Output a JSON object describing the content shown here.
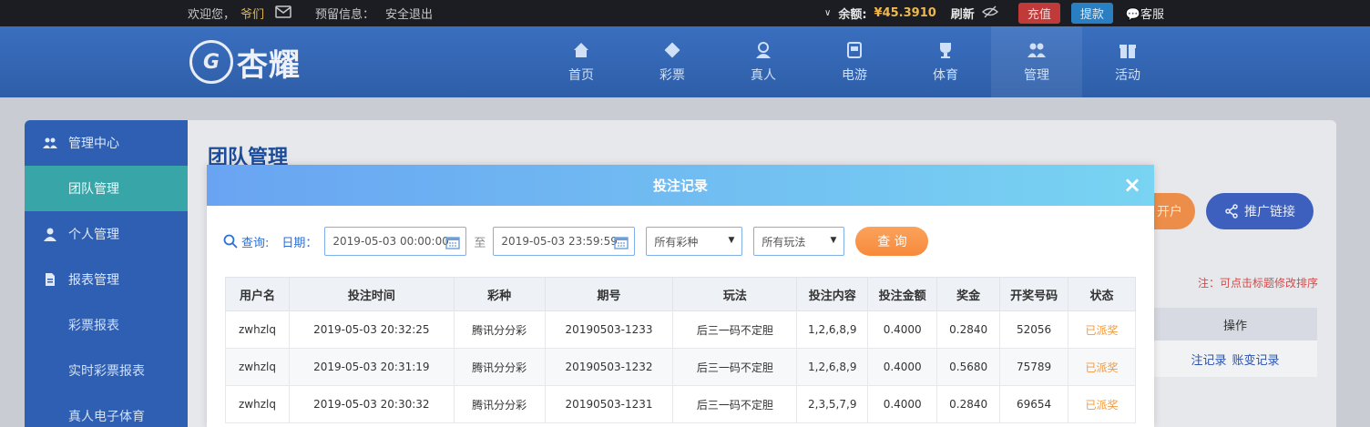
{
  "topbar": {
    "welcome": "欢迎您，",
    "username": "爷们",
    "reserved_label": "预留信息：",
    "logout": "安全退出",
    "balance_label": "余额:",
    "balance_value": "¥45.3910",
    "refresh": "刷新",
    "recharge": "充值",
    "withdraw": "提款",
    "service": "客服"
  },
  "header": {
    "logo_text": "杏耀",
    "nav": [
      {
        "label": "首页",
        "icon": "home-icon"
      },
      {
        "label": "彩票",
        "icon": "lottery-icon"
      },
      {
        "label": "真人",
        "icon": "live-dealer-icon"
      },
      {
        "label": "电游",
        "icon": "slot-machine-icon"
      },
      {
        "label": "体育",
        "icon": "trophy-icon"
      },
      {
        "label": "管理",
        "icon": "users-icon"
      },
      {
        "label": "活动",
        "icon": "gift-icon"
      }
    ]
  },
  "sidebar": {
    "items": [
      {
        "label": "管理中心",
        "type": "group",
        "icon": "users-icon"
      },
      {
        "label": "团队管理",
        "type": "sub",
        "active": true
      },
      {
        "label": "个人管理",
        "type": "group",
        "icon": "user-icon"
      },
      {
        "label": "报表管理",
        "type": "group",
        "icon": "report-icon"
      },
      {
        "label": "彩票报表",
        "type": "sub"
      },
      {
        "label": "实时彩票报表",
        "type": "sub"
      },
      {
        "label": "真人电子体育",
        "type": "sub"
      }
    ]
  },
  "main": {
    "title": "团队管理",
    "open_account_btn": "开户",
    "promo_link_btn": "推广链接",
    "note": "注：可点击标题修改排序",
    "op_header": "操作",
    "op_links": [
      "注记录",
      "账变记录"
    ]
  },
  "modal": {
    "title": "投注记录",
    "close": "×",
    "query_label": "查询:",
    "date_label": "日期：",
    "date_from": "2019-05-03 00:00:00",
    "to_label": "至",
    "date_to": "2019-05-03 23:59:59",
    "lottery_select": "所有彩种",
    "play_select": "所有玩法",
    "query_btn": "查 询",
    "columns": [
      "用户名",
      "投注时间",
      "彩种",
      "期号",
      "玩法",
      "投注内容",
      "投注金额",
      "奖金",
      "开奖号码",
      "状态"
    ],
    "rows": [
      [
        "zwhzlq",
        "2019-05-03 20:32:25",
        "腾讯分分彩",
        "20190503-1233",
        "后三一码不定胆",
        "1,2,6,8,9",
        "0.4000",
        "0.2840",
        "52056",
        "已派奖"
      ],
      [
        "zwhzlq",
        "2019-05-03 20:31:19",
        "腾讯分分彩",
        "20190503-1232",
        "后三一码不定胆",
        "1,2,6,8,9",
        "0.4000",
        "0.5680",
        "75789",
        "已派奖"
      ],
      [
        "zwhzlq",
        "2019-05-03 20:30:32",
        "腾讯分分彩",
        "20190503-1231",
        "后三一码不定胆",
        "2,3,5,7,9",
        "0.4000",
        "0.2840",
        "69654",
        "已派奖"
      ]
    ]
  },
  "colors": {
    "header_blue": "#2e5ea8",
    "sidebar_blue": "#2f5fb3",
    "active_teal": "#38a6a8",
    "accent_orange": "#f78a3c",
    "status_orange": "#f09a3c",
    "balance_gold": "#f0b84a"
  }
}
